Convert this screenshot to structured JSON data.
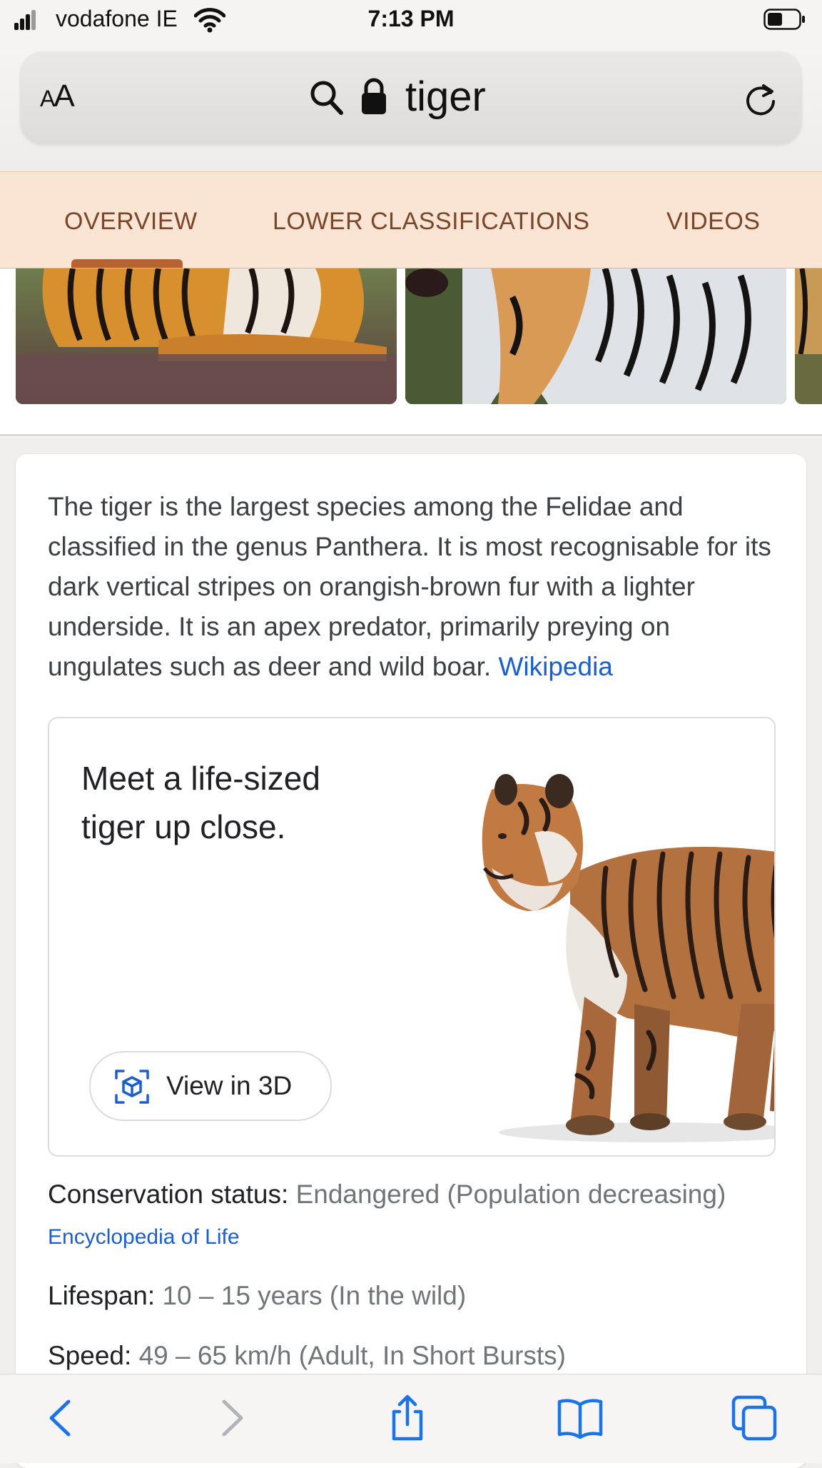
{
  "status_bar": {
    "carrier": "vodafone IE",
    "time": "7:13 PM"
  },
  "url_bar": {
    "text_size_label_small": "A",
    "text_size_label_large": "A",
    "query": "tiger"
  },
  "tabs": [
    {
      "label": "OVERVIEW",
      "selected": true
    },
    {
      "label": "LOWER CLASSIFICATIONS",
      "selected": false
    },
    {
      "label": "VIDEOS",
      "selected": false
    }
  ],
  "description": {
    "text": "The tiger is the largest species among the Felidae and classified in the genus Panthera. It is most recognisable for its dark vertical stripes on orangish-brown fur with a lighter underside. It is an apex predator, primarily preying on ungulates such as deer and wild boar.",
    "source_link": "Wikipedia"
  },
  "ar_card": {
    "title_line1": "Meet a life-sized",
    "title_line2": "tiger up close.",
    "button_label": "View in 3D"
  },
  "facts": [
    {
      "label": "Conservation status:",
      "value": "Endangered (Population decreasing)"
    },
    {
      "label": "Lifespan:",
      "value": "10 – 15 years (In the wild)"
    },
    {
      "label": "Speed:",
      "value": "49 – 65 km/h (Adult, In Short Bursts)"
    }
  ],
  "conservation_source": "Encyclopedia of Life",
  "colors": {
    "tab_background": "#fae4d3",
    "tab_text": "#7a4528",
    "tab_indicator": "#b8632f",
    "link": "#1a5fd0",
    "toolbar_icon_active": "#1a73e8",
    "toolbar_icon_disabled": "#b0b4b8"
  },
  "toolbar_icons": [
    "back-icon",
    "forward-icon",
    "share-icon",
    "bookmarks-icon",
    "tabs-icon"
  ]
}
